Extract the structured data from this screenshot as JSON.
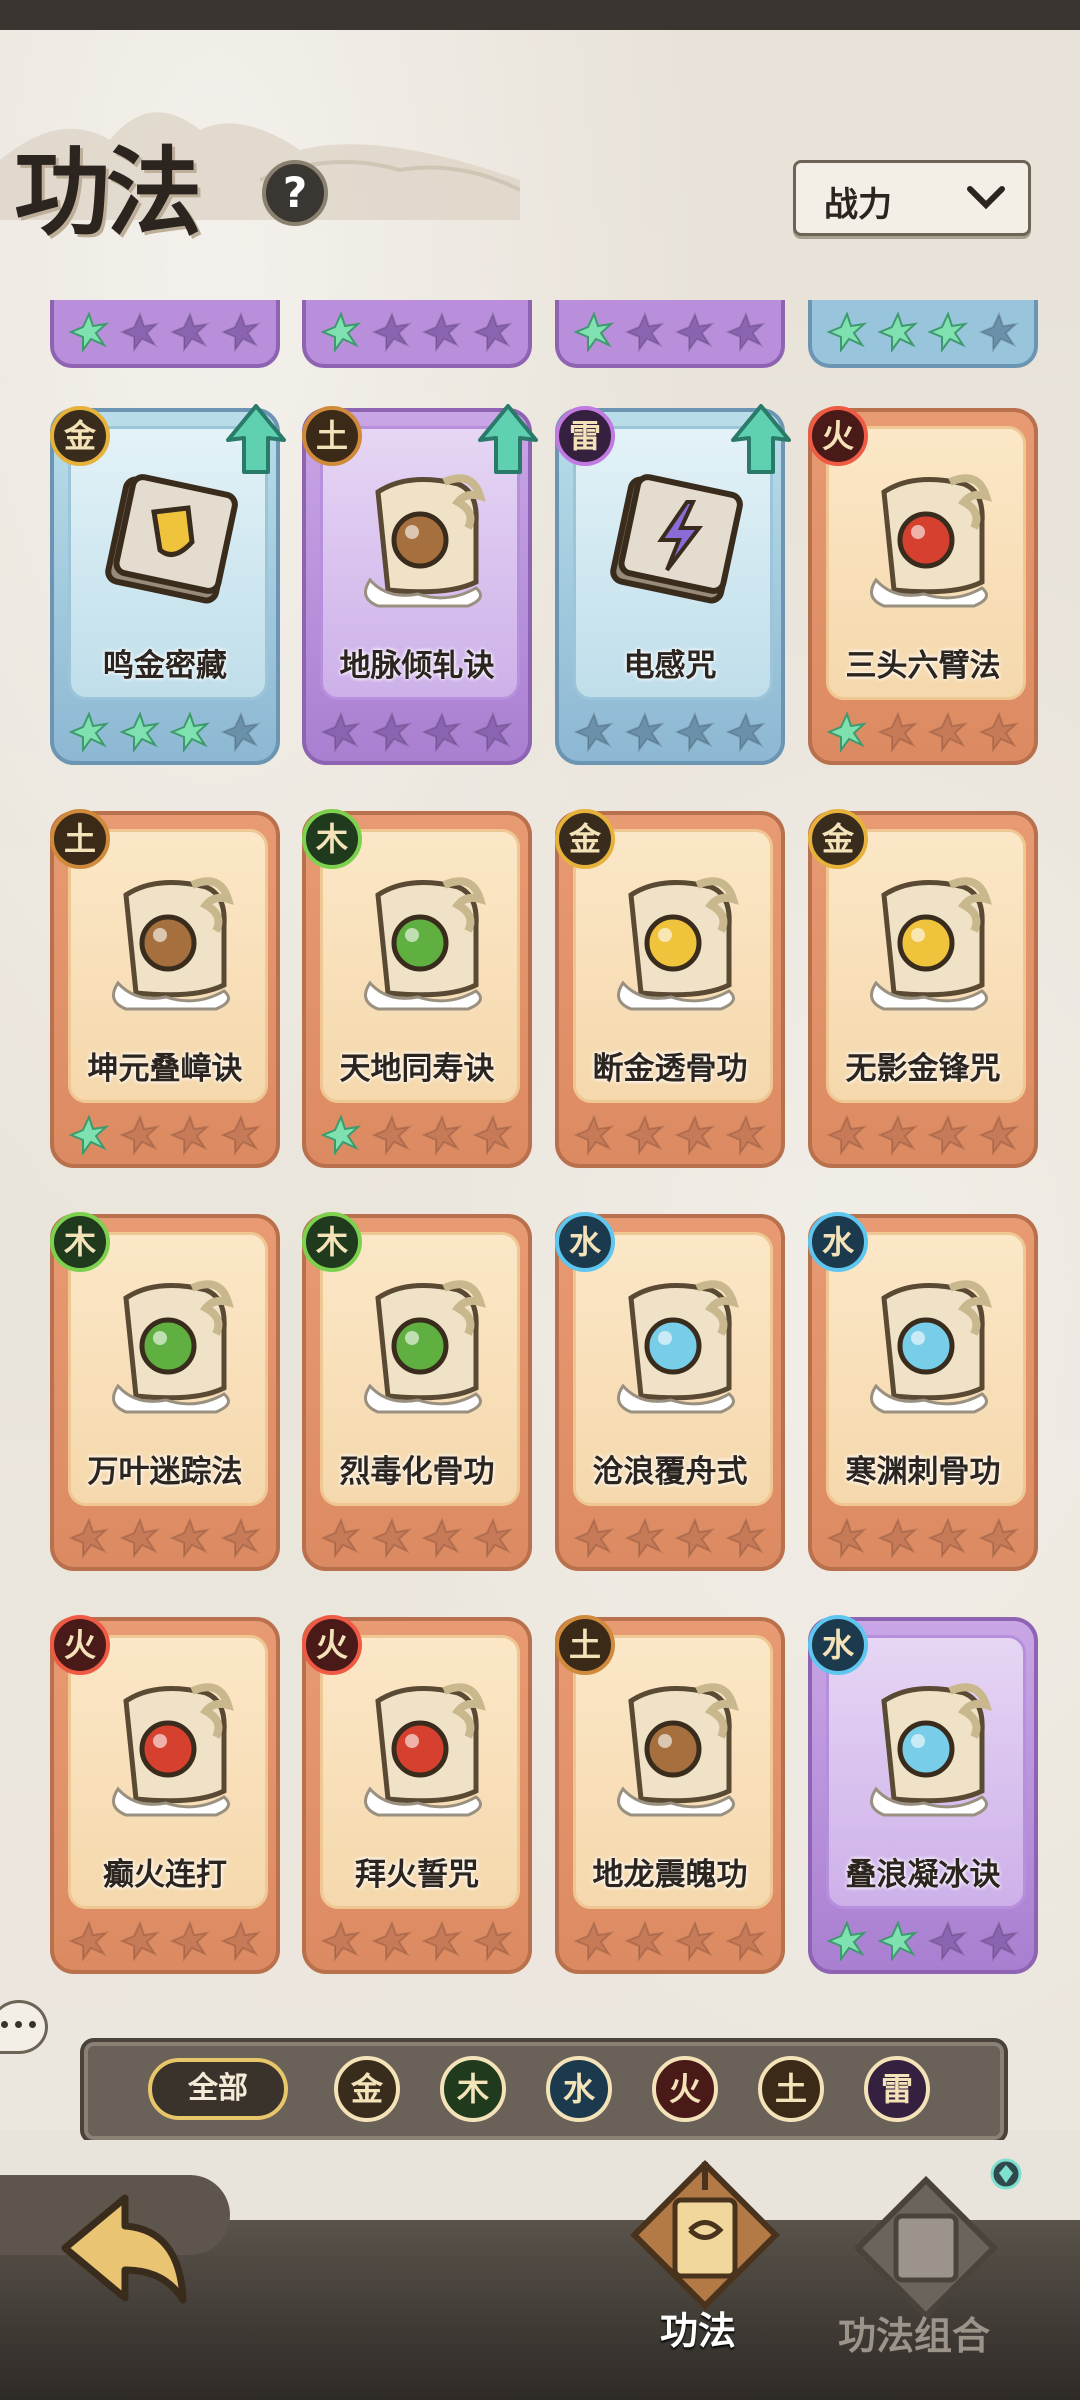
{
  "header": {
    "title": "功法",
    "help": "?",
    "sort_label": "战力"
  },
  "top_row": [
    {
      "theme": "purple",
      "lit": 1
    },
    {
      "theme": "purple",
      "lit": 1
    },
    {
      "theme": "purple",
      "lit": 1
    },
    {
      "theme": "blue",
      "lit": 3
    }
  ],
  "cards": [
    {
      "name": "鸣金密藏",
      "element": "金",
      "elem_key": "gold",
      "theme": "blue",
      "stars_lit": 3,
      "upgrade": true,
      "art": "gold-book"
    },
    {
      "name": "地脉倾轧诀",
      "element": "土",
      "elem_key": "earth",
      "theme": "purple",
      "stars_lit": 0,
      "upgrade": true,
      "art": "earth-scroll"
    },
    {
      "name": "电感咒",
      "element": "雷",
      "elem_key": "thunder",
      "theme": "blue",
      "stars_lit": 0,
      "upgrade": true,
      "art": "thunder-book"
    },
    {
      "name": "三头六臂法",
      "element": "火",
      "elem_key": "fire",
      "theme": "orange",
      "stars_lit": 1,
      "upgrade": false,
      "art": "fire-scroll"
    },
    {
      "name": "坤元叠嶂诀",
      "element": "土",
      "elem_key": "earth",
      "theme": "orange",
      "stars_lit": 1,
      "upgrade": false,
      "art": "earth-scroll"
    },
    {
      "name": "天地同寿诀",
      "element": "木",
      "elem_key": "wood",
      "theme": "orange",
      "stars_lit": 1,
      "upgrade": false,
      "art": "wood-scroll"
    },
    {
      "name": "断金透骨功",
      "element": "金",
      "elem_key": "gold",
      "theme": "orange",
      "stars_lit": 0,
      "upgrade": false,
      "art": "gold-scroll"
    },
    {
      "name": "无影金锋咒",
      "element": "金",
      "elem_key": "gold",
      "theme": "orange",
      "stars_lit": 0,
      "upgrade": false,
      "art": "gold-scroll"
    },
    {
      "name": "万叶迷踪法",
      "element": "木",
      "elem_key": "wood",
      "theme": "orange",
      "stars_lit": 0,
      "upgrade": false,
      "art": "wood-scroll"
    },
    {
      "name": "烈毒化骨功",
      "element": "木",
      "elem_key": "wood",
      "theme": "orange",
      "stars_lit": 0,
      "upgrade": false,
      "art": "wood-scroll"
    },
    {
      "name": "沧浪覆舟式",
      "element": "水",
      "elem_key": "water",
      "theme": "orange",
      "stars_lit": 0,
      "upgrade": false,
      "art": "water-scroll"
    },
    {
      "name": "寒渊刺骨功",
      "element": "水",
      "elem_key": "water",
      "theme": "orange",
      "stars_lit": 0,
      "upgrade": false,
      "art": "water-scroll"
    },
    {
      "name": "癫火连打",
      "element": "火",
      "elem_key": "fire",
      "theme": "orange",
      "stars_lit": 0,
      "upgrade": false,
      "art": "fire-scroll"
    },
    {
      "name": "拜火誓咒",
      "element": "火",
      "elem_key": "fire",
      "theme": "orange",
      "stars_lit": 0,
      "upgrade": false,
      "art": "fire-scroll"
    },
    {
      "name": "地龙震魄功",
      "element": "土",
      "elem_key": "earth",
      "theme": "orange",
      "stars_lit": 0,
      "upgrade": false,
      "art": "earth-scroll"
    },
    {
      "name": "叠浪凝冰诀",
      "element": "水",
      "elem_key": "water",
      "theme": "purple",
      "stars_lit": 2,
      "upgrade": false,
      "art": "water-scroll"
    }
  ],
  "filters": {
    "all_label": "全部",
    "items": [
      {
        "label": "金",
        "key": "gold"
      },
      {
        "label": "木",
        "key": "wood"
      },
      {
        "label": "水",
        "key": "water"
      },
      {
        "label": "火",
        "key": "fire"
      },
      {
        "label": "土",
        "key": "earth"
      },
      {
        "label": "雷",
        "key": "thunder"
      }
    ]
  },
  "nav": {
    "tab1": "功法",
    "tab2": "功法组合"
  },
  "colors": {
    "gold": "#e6b23c",
    "wood": "#7ed04f",
    "water": "#5fc6f0",
    "fire": "#ef5a45",
    "earth": "#cf8a3c",
    "thunder": "#c07ae0",
    "star_lit": "#7fe0b0",
    "star_dim_orange": "#c77a58",
    "star_dim_purple": "#8a64b0",
    "star_dim_blue": "#6a90aa"
  }
}
